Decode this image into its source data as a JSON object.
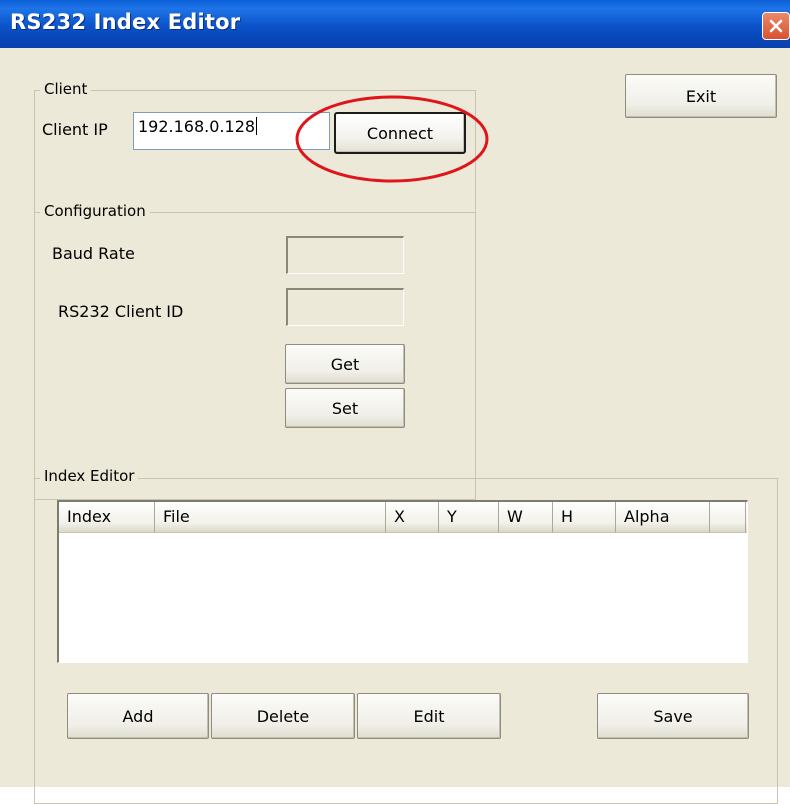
{
  "window": {
    "title": "RS232 Index Editor",
    "close_icon": "close-icon"
  },
  "exit_button": {
    "label": "Exit"
  },
  "client_group": {
    "label": "Client",
    "ip_label": "Client IP",
    "ip_value": "192.168.0.128",
    "connect_label": "Connect"
  },
  "configuration_group": {
    "label": "Configuration",
    "baud_rate_label": "Baud Rate",
    "baud_rate_value": "",
    "client_id_label": "RS232 Client ID",
    "client_id_value": "",
    "get_label": "Get",
    "set_label": "Set"
  },
  "index_editor": {
    "label": "Index Editor",
    "columns": [
      "Index",
      "File",
      "X",
      "Y",
      "W",
      "H",
      "Alpha",
      ""
    ],
    "rows": [],
    "add_label": "Add",
    "delete_label": "Delete",
    "edit_label": "Edit",
    "save_label": "Save"
  },
  "annotation": {
    "color": "#e0151b"
  }
}
